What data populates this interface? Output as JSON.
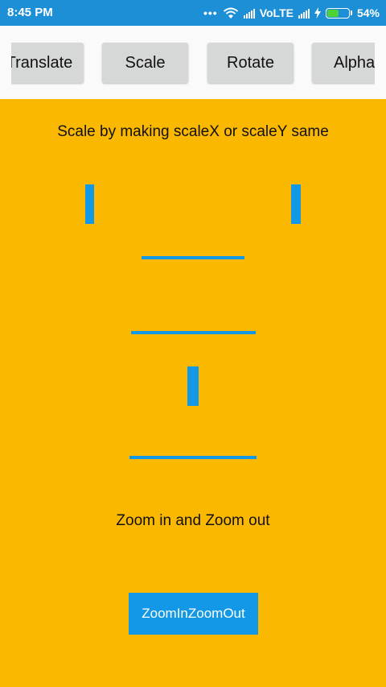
{
  "status_bar": {
    "time": "8:45 PM",
    "dots": "•••",
    "network_label": "VoLTE",
    "battery_percent": "54%",
    "battery_level": 0.54,
    "icons": [
      "wifi-icon",
      "signal-icon",
      "signal-icon",
      "charging-icon",
      "battery-icon"
    ]
  },
  "tabs": [
    "Translate",
    "Scale",
    "Rotate",
    "Alpha"
  ],
  "main": {
    "title": "Scale by making scaleX or scaleY same",
    "zoom_title": "Zoom in and Zoom out",
    "zoom_button_label": "ZoomInZoomOut"
  },
  "colors": {
    "status_bar": "#1D8FD6",
    "background": "#FBB800",
    "accent": "#1298E6",
    "tab_button": "#D6D7D7"
  }
}
